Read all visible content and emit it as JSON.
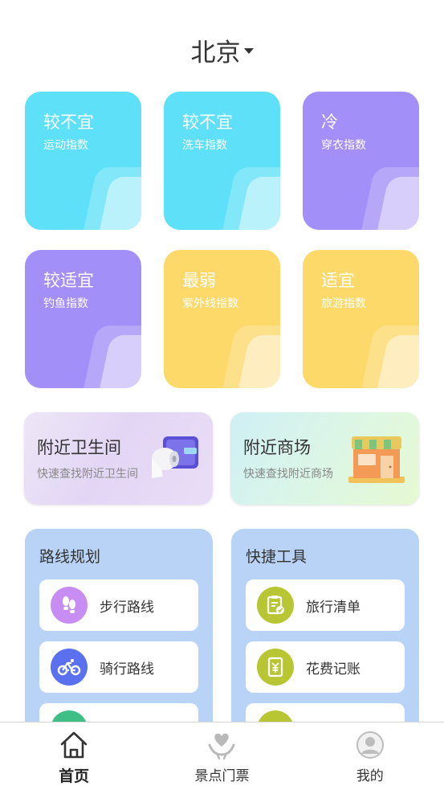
{
  "header": {
    "city": "北京"
  },
  "indices": [
    {
      "value": "较不宜",
      "label": "运动指数",
      "color": "cyan"
    },
    {
      "value": "较不宜",
      "label": "洗车指数",
      "color": "cyan"
    },
    {
      "value": "冷",
      "label": "穿衣指数",
      "color": "purple"
    },
    {
      "value": "较适宜",
      "label": "钓鱼指数",
      "color": "purple"
    },
    {
      "value": "最弱",
      "label": "紫外线指数",
      "color": "yellow"
    },
    {
      "value": "适宜",
      "label": "旅游指数",
      "color": "yellow"
    }
  ],
  "nearby": {
    "toilet": {
      "title": "附近卫生间",
      "subtitle": "快速查找附近卫生间"
    },
    "mall": {
      "title": "附近商场",
      "subtitle": "快速查找附近商场"
    }
  },
  "route": {
    "title": "路线规划",
    "items": [
      {
        "label": "步行路线",
        "icon": "footprints-icon"
      },
      {
        "label": "骑行路线",
        "icon": "bicycle-icon"
      },
      {
        "label": "",
        "icon": "transit-icon"
      }
    ]
  },
  "tools": {
    "title": "快捷工具",
    "items": [
      {
        "label": "旅行清单",
        "icon": "checklist-icon"
      },
      {
        "label": "花费记账",
        "icon": "expense-icon"
      },
      {
        "label": "",
        "icon": "tool-icon"
      }
    ]
  },
  "tabbar": [
    {
      "label": "首页",
      "icon": "home-icon",
      "active": true
    },
    {
      "label": "景点门票",
      "icon": "ticket-heart-icon",
      "active": false
    },
    {
      "label": "我的",
      "icon": "profile-icon",
      "active": false
    }
  ],
  "colors": {
    "cyan": "#5ee1f8",
    "purple": "#a28ff8",
    "yellow": "#fdd96a",
    "panel": "#b8d3f6",
    "walk_icon_bg": "#c88df2",
    "bike_icon_bg": "#5b70ee",
    "tool_icon_bg": "#b8c633"
  }
}
